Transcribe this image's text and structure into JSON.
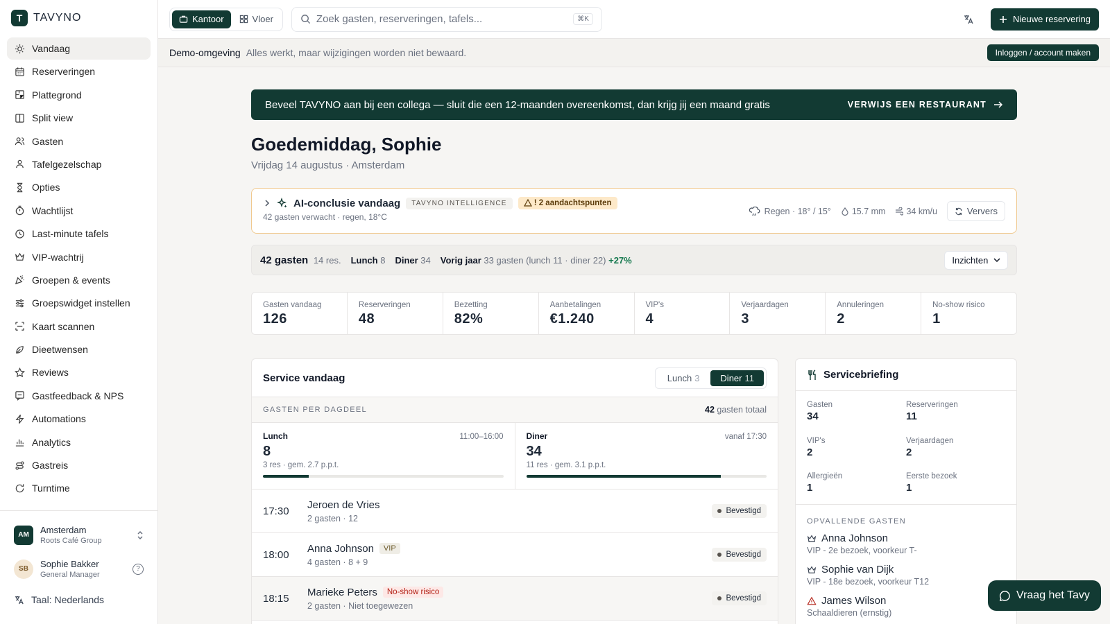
{
  "brand": {
    "name": "TAVYNO",
    "logo_letter": "T"
  },
  "sidebar": {
    "items": [
      {
        "label": "Vandaag",
        "icon": "sun-icon",
        "active": true
      },
      {
        "label": "Reserveringen",
        "icon": "calendar-icon"
      },
      {
        "label": "Plattegrond",
        "icon": "floorplan-icon"
      },
      {
        "label": "Split view",
        "icon": "columns-icon"
      },
      {
        "label": "Gasten",
        "icon": "users-icon"
      },
      {
        "label": "Tafelgezelschap",
        "icon": "user-group-icon"
      },
      {
        "label": "Opties",
        "icon": "hourglass-icon"
      },
      {
        "label": "Wachtlijst",
        "icon": "timer-icon"
      },
      {
        "label": "Last-minute tafels",
        "icon": "clock-icon"
      },
      {
        "label": "VIP-wachtrij",
        "icon": "crown-icon"
      },
      {
        "label": "Groepen & events",
        "icon": "party-icon"
      },
      {
        "label": "Groepswidget instellen",
        "icon": "sliders-icon"
      },
      {
        "label": "Kaart scannen",
        "icon": "scan-icon"
      },
      {
        "label": "Dieetwensen",
        "icon": "leaf-icon"
      },
      {
        "label": "Reviews",
        "icon": "star-icon"
      },
      {
        "label": "Gastfeedback & NPS",
        "icon": "message-icon"
      },
      {
        "label": "Automations",
        "icon": "bolt-icon"
      },
      {
        "label": "Analytics",
        "icon": "bar-chart-icon"
      },
      {
        "label": "Gastreis",
        "icon": "route-icon"
      },
      {
        "label": "Turntime",
        "icon": "refresh-clock-icon"
      }
    ],
    "location": {
      "initials": "AM",
      "name": "Amsterdam",
      "group": "Roots Café Group"
    },
    "user": {
      "initials": "SB",
      "name": "Sophie Bakker",
      "role": "General Manager"
    },
    "language": "Taal: Nederlands"
  },
  "topbar": {
    "mode_office": "Kantoor",
    "mode_floor": "Vloer",
    "search_placeholder": "Zoek gasten, reserveringen, tafels...",
    "search_shortcut": "⌘K",
    "new_reservation": "Nieuwe reservering"
  },
  "demo": {
    "title": "Demo-omgeving",
    "text": "Alles werkt, maar wijzigingen worden niet bewaard.",
    "login": "Inloggen / account maken"
  },
  "referral": {
    "text": "Beveel TAVYNO aan bij een collega — sluit die een 12-maanden overeenkomst, dan krijg jij een maand gratis",
    "cta": "VERWIJS EEN RESTAURANT"
  },
  "greeting": {
    "title": "Goedemiddag, Sophie",
    "date": "Vrijdag 14 augustus · Amsterdam"
  },
  "ai": {
    "title": "AI-conclusie vandaag",
    "tag": "TAVYNO INTELLIGENCE",
    "warning": "! 2 aandachtspunten",
    "subtitle": "42 gasten verwacht · regen, 18°C",
    "weather": "Regen · 18° / 15°",
    "rain": "15.7 mm",
    "wind": "34 km/u",
    "refresh": "Ververs"
  },
  "summary": {
    "guests": "42 gasten",
    "res": "14 res.",
    "lunch_label": "Lunch",
    "lunch_value": "8",
    "dinner_label": "Diner",
    "dinner_value": "34",
    "last_year_label": "Vorig jaar",
    "last_year_text": "33 gasten (lunch 11 · diner 22)",
    "delta": "+27%",
    "insights": "Inzichten"
  },
  "stats": [
    {
      "label": "Gasten vandaag",
      "value": "126"
    },
    {
      "label": "Reserveringen",
      "value": "48"
    },
    {
      "label": "Bezetting",
      "value": "82%"
    },
    {
      "label": "Aanbetalingen",
      "value": "€1.240"
    },
    {
      "label": "VIP's",
      "value": "4"
    },
    {
      "label": "Verjaardagen",
      "value": "3"
    },
    {
      "label": "Annuleringen",
      "value": "2"
    },
    {
      "label": "No-show risico",
      "value": "1"
    }
  ],
  "service": {
    "title": "Service vandaag",
    "toggle_lunch": "Lunch",
    "toggle_lunch_n": "3",
    "toggle_dinner": "Diner",
    "toggle_dinner_n": "11",
    "section_label": "GASTEN PER DAGDEEL",
    "total_value": "42",
    "total_label": "gasten totaal",
    "lunch": {
      "name": "Lunch",
      "time": "11:00–16:00",
      "value": "8",
      "sub": "3 res · gem. 2.7 p.p.t.",
      "fill": 0.19
    },
    "dinner": {
      "name": "Diner",
      "time": "vanaf 17:30",
      "value": "34",
      "sub": "11 res · gem. 3.1 p.p.t.",
      "fill": 0.81
    },
    "reservations": [
      {
        "time": "17:30",
        "name": "Jeroen de Vries",
        "sub": "2 gasten · 12",
        "status": "Bevestigd"
      },
      {
        "time": "18:00",
        "name": "Anna Johnson",
        "chip": "VIP",
        "sub": "4 gasten · 8 + 9",
        "status": "Bevestigd"
      },
      {
        "time": "18:15",
        "name": "Marieke Peters",
        "chip": "No-show risico",
        "sub": "2 gasten · Niet toegewezen",
        "status": "Bevestigd"
      }
    ]
  },
  "briefing": {
    "title": "Servicebriefing",
    "grid": [
      {
        "label": "Gasten",
        "value": "34"
      },
      {
        "label": "Reserveringen",
        "value": "11"
      },
      {
        "label": "VIP's",
        "value": "2"
      },
      {
        "label": "Verjaardagen",
        "value": "2"
      },
      {
        "label": "Allergieën",
        "value": "1"
      },
      {
        "label": "Eerste bezoek",
        "value": "1"
      }
    ],
    "notable_title": "OPVALLENDE GASTEN",
    "notable": [
      {
        "name": "Anna Johnson",
        "sub": "VIP - 2e bezoek, voorkeur T-",
        "icon": "crown-icon"
      },
      {
        "name": "Sophie van Dijk",
        "sub": "VIP - 18e bezoek, voorkeur T12",
        "icon": "crown-icon"
      },
      {
        "name": "James Wilson",
        "sub": "Schaaldieren (ernstig)",
        "icon": "warning-icon"
      }
    ]
  },
  "assistant": {
    "label": "Vraag het Tavy"
  },
  "colors": {
    "brand": "#123a33",
    "warning_border": "#f0c98f",
    "positive": "#16794f",
    "risk": "#b42318"
  }
}
